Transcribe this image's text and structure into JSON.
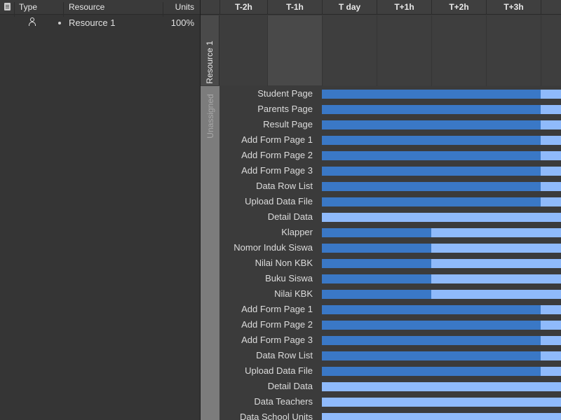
{
  "left_table": {
    "headers": {
      "type": "Type",
      "resource": "Resource",
      "units": "Units"
    },
    "rows": [
      {
        "type_icon": "person-icon",
        "bullet": "bullet-icon",
        "resource": "Resource 1",
        "units": "100%"
      }
    ]
  },
  "timeline": {
    "columns": [
      "T-2h",
      "T-1h",
      "T day",
      "T+1h",
      "T+2h",
      "T+3h"
    ]
  },
  "groups": {
    "resource": "Resource 1",
    "unassigned": "Unassigned"
  },
  "colors": {
    "bar_done": "#3a78c6",
    "bar_remaining": "#8fbafb",
    "background": "#353535"
  },
  "tasks": [
    {
      "name": "Student Page",
      "progress": 0.915
    },
    {
      "name": "Parents Page",
      "progress": 0.915
    },
    {
      "name": "Result Page",
      "progress": 0.915
    },
    {
      "name": "Add Form Page 1",
      "progress": 0.915
    },
    {
      "name": "Add Form Page 2",
      "progress": 0.915
    },
    {
      "name": "Add Form Page 3",
      "progress": 0.915
    },
    {
      "name": "Data Row List",
      "progress": 0.915
    },
    {
      "name": "Upload Data File",
      "progress": 0.915
    },
    {
      "name": "Detail Data",
      "progress": 0
    },
    {
      "name": "Klapper",
      "progress": 0.457
    },
    {
      "name": "Nomor Induk Siswa",
      "progress": 0.457
    },
    {
      "name": "Nilai Non KBK",
      "progress": 0.457
    },
    {
      "name": "Buku Siswa",
      "progress": 0.457
    },
    {
      "name": "Nilai KBK",
      "progress": 0.457
    },
    {
      "name": "Add Form Page 1",
      "progress": 0.915
    },
    {
      "name": "Add Form Page 2",
      "progress": 0.915
    },
    {
      "name": "Add Form Page 3",
      "progress": 0.915
    },
    {
      "name": "Data Row List",
      "progress": 0.915
    },
    {
      "name": "Upload Data File",
      "progress": 0.915
    },
    {
      "name": "Detail Data",
      "progress": 0
    },
    {
      "name": "Data Teachers",
      "progress": 0
    },
    {
      "name": "Data School Units",
      "progress": 0
    }
  ]
}
